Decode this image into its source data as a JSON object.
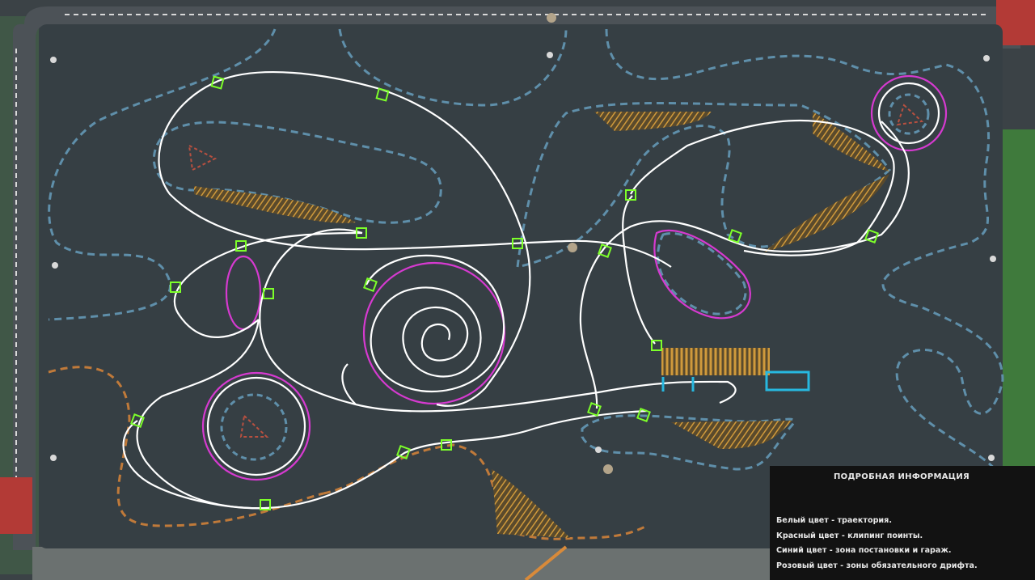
{
  "legend": {
    "title": "ПОДРОБНАЯ ИНФОРМАЦИЯ",
    "lines": [
      "Белый цвет  - траектория.",
      "Красный цвет - клипинг поинты.",
      "Синий цвет - зона постановки и гараж.",
      "Розовый цвет - зоны обязательного дрифта."
    ]
  },
  "colors": {
    "asphalt": "#363f44",
    "grass": "#3f7a3c",
    "trajectory": "#ffffff",
    "clipping_point": "#7dff2a",
    "drift_zone": "#d63ad0",
    "garage_zone": "#27b8e0",
    "curb_blue": "#5f8faa",
    "curb_orange": "#c07a3a",
    "hatch": "#c8963c",
    "panel_bg": "#121212"
  }
}
